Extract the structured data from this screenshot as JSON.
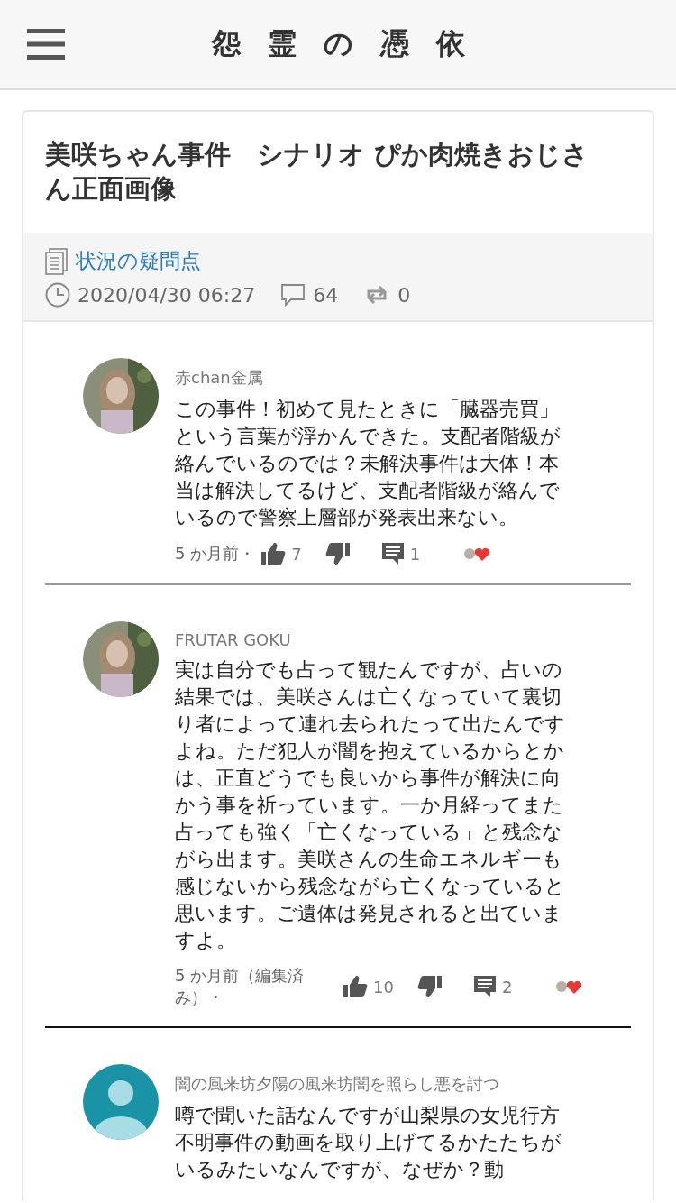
{
  "header": {
    "title": "怨霊の憑依"
  },
  "article": {
    "title": "美咲ちゃん事件　シナリオ ぴか肉焼きおじさん正面画像",
    "category": "状況の疑問点",
    "date": "2020/04/30 06:27",
    "comment_count": "64",
    "repost_count": "0"
  },
  "comments": [
    {
      "author": "赤chan金属",
      "text": "この事件！初めて見たときに「臓器売買」という言葉が浮かんできた。支配者階級が絡んでいるのでは？未解決事件は大体！本当は解決してるけど、支配者階級が絡んでいるので警察上層部が発表出来ない。",
      "time": "5 か月前・",
      "likes": "7",
      "replies": "1",
      "hearted": true,
      "divider": {
        "kind": "light"
      }
    },
    {
      "author": "FRUTAR GOKU",
      "text": "実は自分でも占って観たんですが、占いの結果では、美咲さんは亡くなっていて裏切り者によって連れ去られたって出たんですよね。ただ犯人が闇を抱えているからとかは、正直どうでも良いから事件が解決に向かう事を祈っています。一か月経ってまた占っても強く「亡くなっている」と残念ながら出ます。美咲さんの生命エネルギーも感じないから残念ながら亡くなっていると思います。ご遺体は発見されると出ていますよ。",
      "time": "5 か月前（編集済み）・",
      "likes": "10",
      "replies": "2",
      "hearted": true,
      "divider": {
        "kind": "dark"
      }
    },
    {
      "avatar": {
        "kind": "default"
      },
      "author": "闇の風来坊夕陽の風来坊闇を照らし悪を討つ",
      "text": "噂で聞いた話なんですが山梨県の女児行方不明事件の動画を取り上げてるかたたちがいるみたいなんですが、なぜか？動"
    }
  ]
}
